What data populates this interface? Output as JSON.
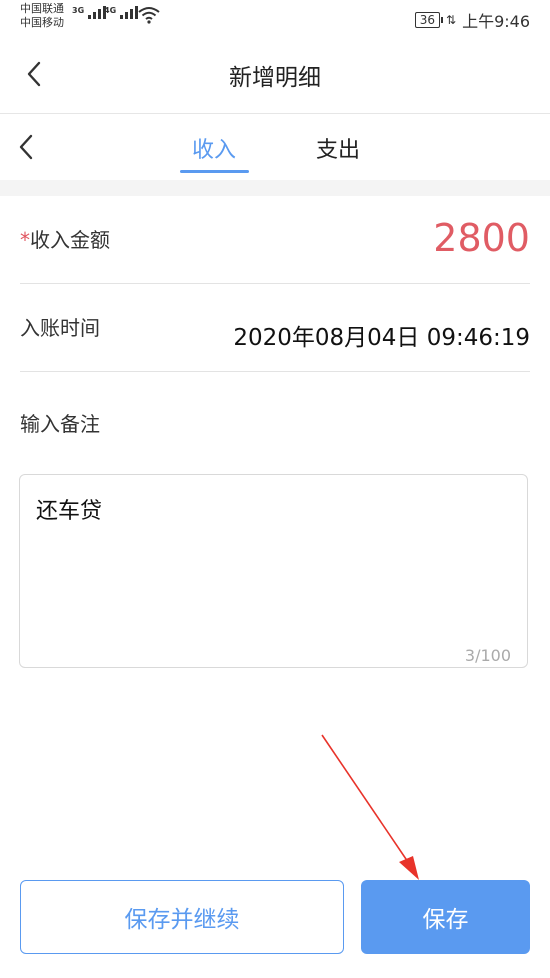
{
  "status_bar": {
    "carrier_1": "中国联通",
    "carrier_2": "中国移动",
    "network_1": "3G",
    "network_2": "4G",
    "battery": "36",
    "time": "上午9:46"
  },
  "header": {
    "title": "新增明细",
    "back_icon": "chevron-left-icon"
  },
  "tabs": [
    {
      "label": "收入",
      "active": true
    },
    {
      "label": "支出",
      "active": false
    }
  ],
  "form": {
    "amount": {
      "required_mark": "*",
      "label": "收入金额",
      "value": "2800"
    },
    "time": {
      "label": "入账时间",
      "value": "2020年08月04日 09:46:19"
    },
    "note": {
      "label": "输入备注",
      "value": "还车贷",
      "counter": "3/100"
    }
  },
  "actions": {
    "save_continue": "保存并继续",
    "save": "保存"
  },
  "colors": {
    "accent": "#5a9af0",
    "amount": "#e05c64",
    "annotation_arrow": "#e8332a"
  }
}
